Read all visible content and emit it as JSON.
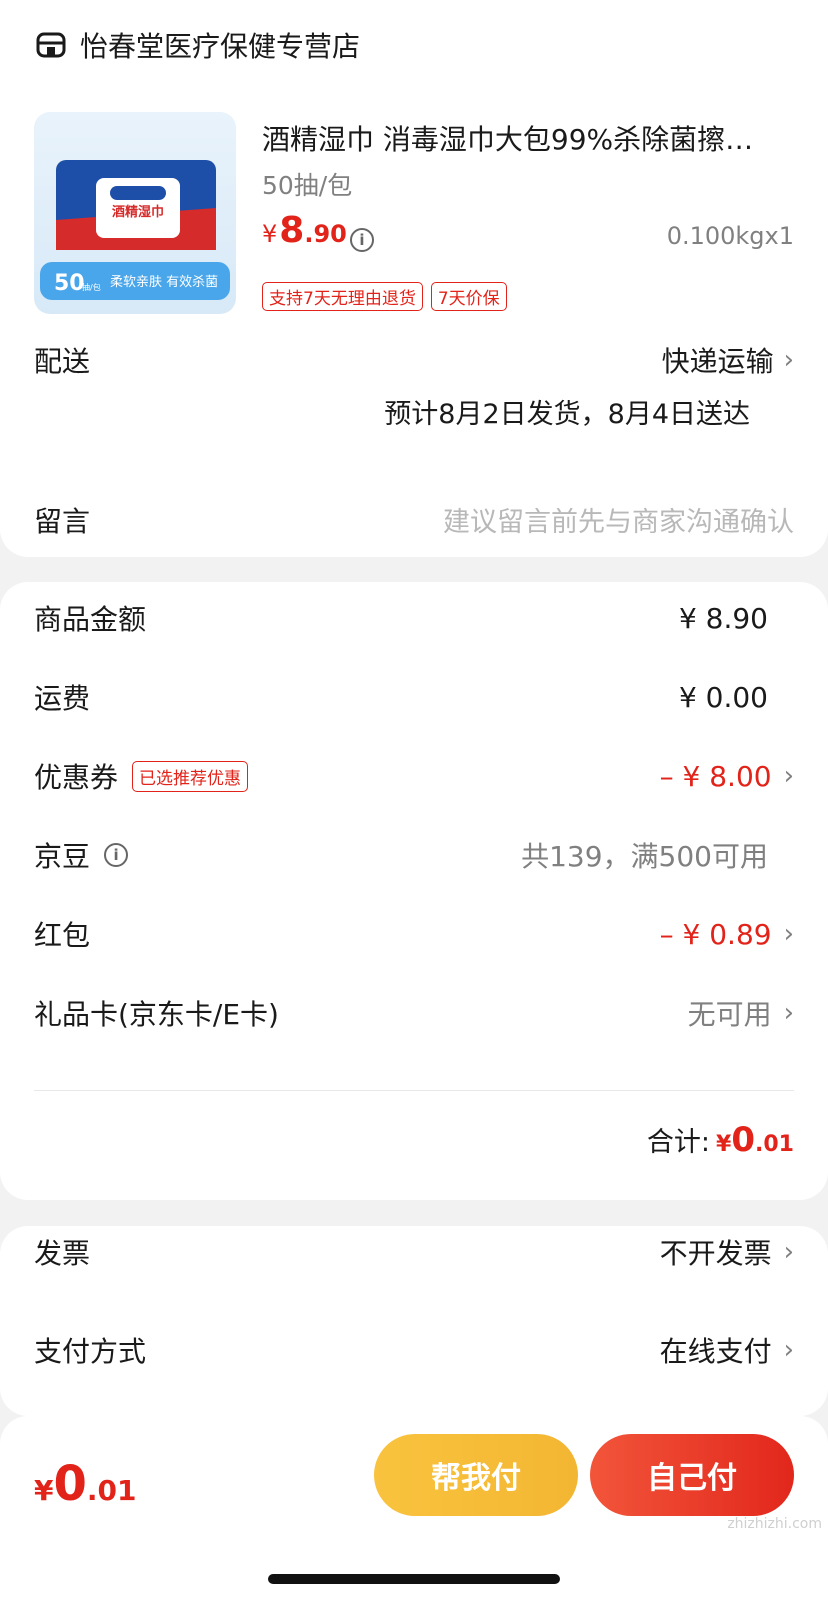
{
  "store": {
    "name": "怡春堂医疗保健专营店",
    "icon": "store-icon"
  },
  "product": {
    "title": "酒精湿巾 消毒湿巾大包99%杀除菌擦…",
    "spec": "50抽/包",
    "price_currency": "¥",
    "price_int": "8",
    "price_dec": ".90",
    "weight_qty": "0.100kgx1",
    "tags": [
      "支持7天无理由退货",
      "7天价保"
    ],
    "image": {
      "count_big": "50",
      "count_small": "抽/包",
      "banner": "柔软亲肤 有效杀菌",
      "pack_label": "酒精湿巾"
    }
  },
  "delivery": {
    "label": "配送",
    "method": "快递运输",
    "estimate": "预计8月2日发货，8月4日送达"
  },
  "message": {
    "label": "留言",
    "placeholder": "建议留言前先与商家沟通确认"
  },
  "price_rows": [
    {
      "label": "商品金额",
      "value": "¥ 8.90"
    },
    {
      "label": "运费",
      "value": "¥ 0.00"
    },
    {
      "label": "优惠券",
      "tag": "已选推荐优惠",
      "value": "– ¥ 8.00"
    },
    {
      "label": "京豆",
      "value": "共139，满500可用"
    },
    {
      "label": "红包",
      "value": "– ¥ 0.89"
    },
    {
      "label": "礼品卡(京东卡/E卡)",
      "value": "无可用"
    }
  ],
  "total": {
    "label": "合计:",
    "currency": "¥",
    "int": "0",
    "dec": ".01"
  },
  "invoice": {
    "label": "发票",
    "value": "不开发票"
  },
  "payment": {
    "label": "支付方式",
    "value": "在线支付"
  },
  "bottom": {
    "currency": "¥",
    "int": "0",
    "dec": ".01",
    "help_pay": "帮我付",
    "self_pay": "自己付"
  },
  "watermark": "zhizhizhi.com",
  "colors": {
    "accent_red": "#e2231a",
    "help_yellow": "#f6bd3a",
    "gray_text": "#808080"
  }
}
